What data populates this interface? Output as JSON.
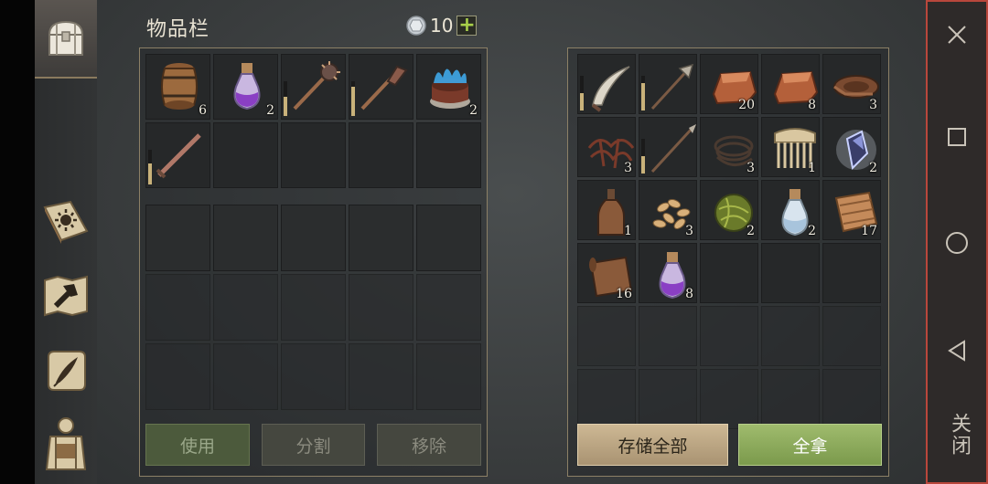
{
  "inventory": {
    "title": "物品栏",
    "currency_amount": "10",
    "add_label": "+",
    "cells": [
      {
        "icon": "barrel-icon",
        "qty": "6"
      },
      {
        "icon": "purple-potion-icon",
        "qty": "2"
      },
      {
        "icon": "spiked-mace-icon",
        "qty": "",
        "durability": 0.55
      },
      {
        "icon": "spiked-club-icon",
        "qty": "",
        "durability": 0.85
      },
      {
        "icon": "blue-flame-cake-icon",
        "qty": "2"
      },
      {
        "icon": "sword-icon",
        "qty": "",
        "durability": 0.6
      },
      {},
      {},
      {},
      {}
    ],
    "buttons": {
      "use": "使用",
      "split": "分割",
      "remove": "移除"
    }
  },
  "storage": {
    "cells": [
      {
        "icon": "scimitar-icon",
        "qty": "",
        "durability": 0.5
      },
      {
        "icon": "halberd-icon",
        "qty": "",
        "durability": 0.8
      },
      {
        "icon": "copper-ingot-icon",
        "qty": "20"
      },
      {
        "icon": "copper-ingot-icon",
        "qty": "8"
      },
      {
        "icon": "leather-roll-icon",
        "qty": "3"
      },
      {
        "icon": "roots-icon",
        "qty": "3"
      },
      {
        "icon": "spear-icon",
        "qty": "",
        "durability": 0.5
      },
      {
        "icon": "rope-coil-icon",
        "qty": "3"
      },
      {
        "icon": "bone-comb-icon",
        "qty": "1"
      },
      {
        "icon": "crystal-icon",
        "qty": "2"
      },
      {
        "icon": "bottle-icon",
        "qty": "1"
      },
      {
        "icon": "seeds-icon",
        "qty": "3"
      },
      {
        "icon": "fiber-ball-icon",
        "qty": "2"
      },
      {
        "icon": "water-potion-icon",
        "qty": "2"
      },
      {
        "icon": "cloth-icon",
        "qty": "17"
      },
      {
        "icon": "leather-scroll-icon",
        "qty": "16"
      },
      {
        "icon": "purple-potion-icon",
        "qty": "8"
      }
    ],
    "buttons": {
      "store_all": "存储全部",
      "take_all": "全拿"
    }
  },
  "system": {
    "close_label": "关闭"
  }
}
